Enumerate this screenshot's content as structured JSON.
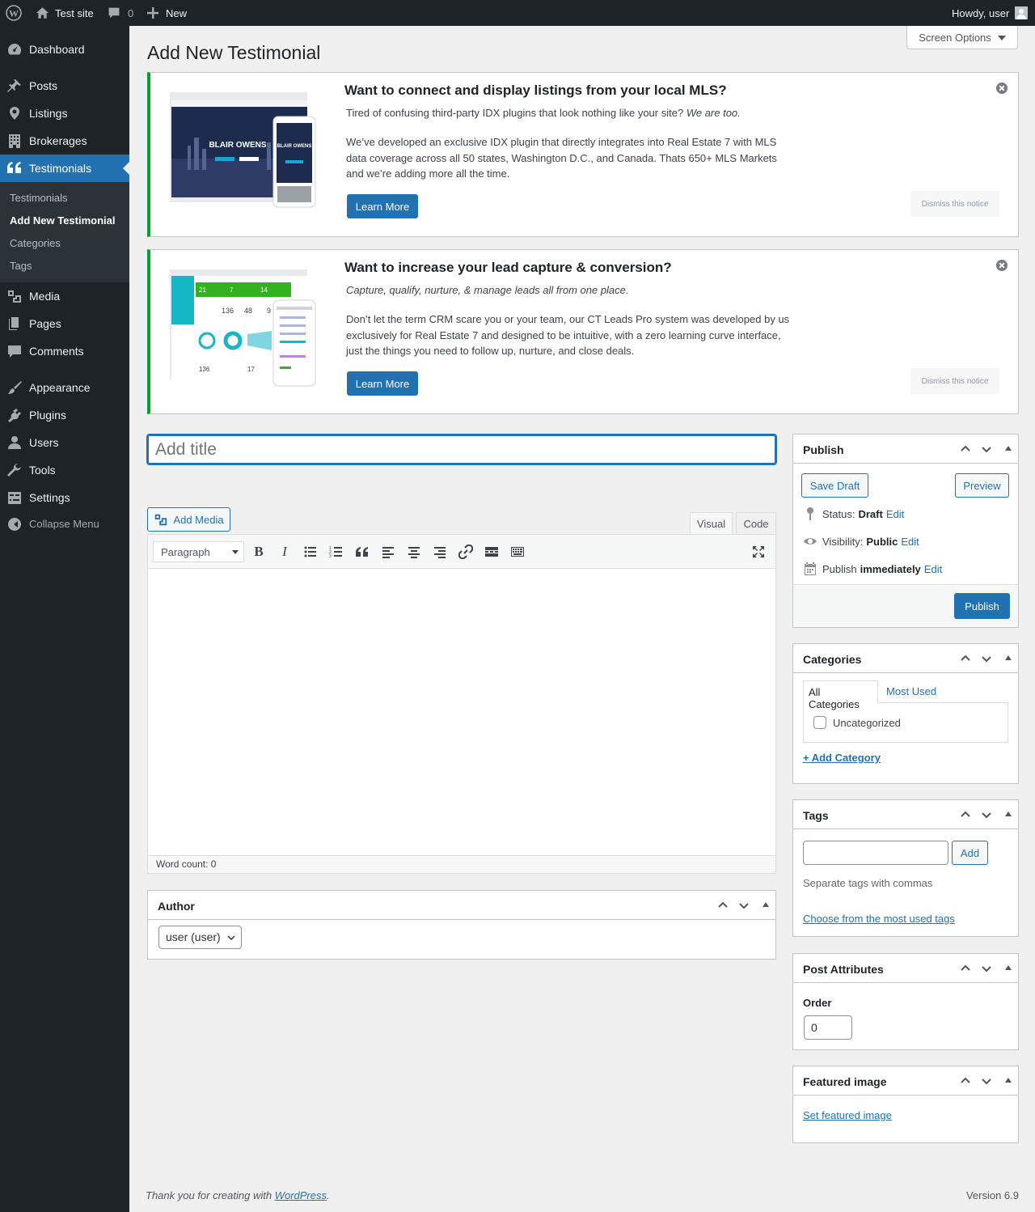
{
  "adminbar": {
    "site_name": "Test site",
    "comments_count": "0",
    "new_label": "New",
    "howdy": "Howdy, user"
  },
  "menu": {
    "items": [
      {
        "label": "Dashboard",
        "icon": "dashboard-icon"
      },
      {
        "label": "Posts",
        "icon": "pin-icon"
      },
      {
        "label": "Listings",
        "icon": "location-icon"
      },
      {
        "label": "Brokerages",
        "icon": "building-icon"
      },
      {
        "label": "Testimonials",
        "icon": "quote-icon"
      },
      {
        "label": "Media",
        "icon": "media-icon"
      },
      {
        "label": "Pages",
        "icon": "pages-icon"
      },
      {
        "label": "Comments",
        "icon": "comment-icon"
      },
      {
        "label": "Appearance",
        "icon": "brush-icon"
      },
      {
        "label": "Plugins",
        "icon": "plugin-icon"
      },
      {
        "label": "Users",
        "icon": "user-icon"
      },
      {
        "label": "Tools",
        "icon": "wrench-icon"
      },
      {
        "label": "Settings",
        "icon": "settings-icon"
      }
    ],
    "submenu": [
      "Testimonials",
      "Add New Testimonial",
      "Categories",
      "Tags"
    ],
    "collapse": "Collapse Menu"
  },
  "screen_options": "Screen Options",
  "page_title": "Add New Testimonial",
  "notices": [
    {
      "title": "Want to connect and display listings from your local MLS?",
      "lead": "Tired of confusing third-party IDX plugins that look nothing like your site?",
      "lead_em": "We are too.",
      "body_1": "We’ve developed an exclusive IDX plugin that directly integrates into Real Estate 7 with MLS",
      "body_2": "data coverage across all 50 states, Washington D.C., and Canada. Thats 650+ MLS Markets",
      "body_3": "and we’re adding more all the time.",
      "thumb_name": "BLAIR OWENS",
      "learn_more": "Learn More",
      "dismiss": "Dismiss this notice"
    },
    {
      "title": "Want to increase your lead capture & conversion?",
      "lead_em": "Capture, qualify, nurture, & manage leads all from one place.",
      "body_1": "Don’t let the term CRM scare you or your team, our CT Leads Pro system was developed by us",
      "body_2": "exclusively for Real Estate 7 and designed to be intuitive, with a zero learning curve interface,",
      "body_3": "just the things you need to follow up, nurture, and close deals.",
      "stats": [
        "21",
        "7",
        "14",
        "136",
        "48",
        "9",
        "136",
        "17"
      ],
      "learn_more": "Learn More",
      "dismiss": "Dismiss this notice"
    }
  ],
  "title_placeholder": "Add title",
  "editor": {
    "add_media": "Add Media",
    "tab_visual": "Visual",
    "tab_code": "Code",
    "format": "Paragraph",
    "word_count": "Word count: 0"
  },
  "author": {
    "title": "Author",
    "value": "user (user)"
  },
  "publish": {
    "title": "Publish",
    "save_draft": "Save Draft",
    "preview": "Preview",
    "status_label": "Status:",
    "status_value": "Draft",
    "visibility_label": "Visibility:",
    "visibility_value": "Public",
    "publish_label": "Publish",
    "publish_value": "immediately",
    "edit": "Edit",
    "publish_button": "Publish"
  },
  "categories": {
    "title": "Categories",
    "tab_all": "All Categories",
    "tab_most": "Most Used",
    "item": "Uncategorized",
    "add": "+ Add Category"
  },
  "tags": {
    "title": "Tags",
    "add": "Add",
    "help": "Separate tags with commas",
    "choose": "Choose from the most used tags"
  },
  "post_attributes": {
    "title": "Post Attributes",
    "order_label": "Order",
    "order_value": "0"
  },
  "featured_image": {
    "title": "Featured image",
    "set": "Set featured image"
  },
  "footer": {
    "thanks": "Thank you for creating with",
    "wp": "WordPress",
    "dot": ".",
    "version": "Version 6.9"
  }
}
